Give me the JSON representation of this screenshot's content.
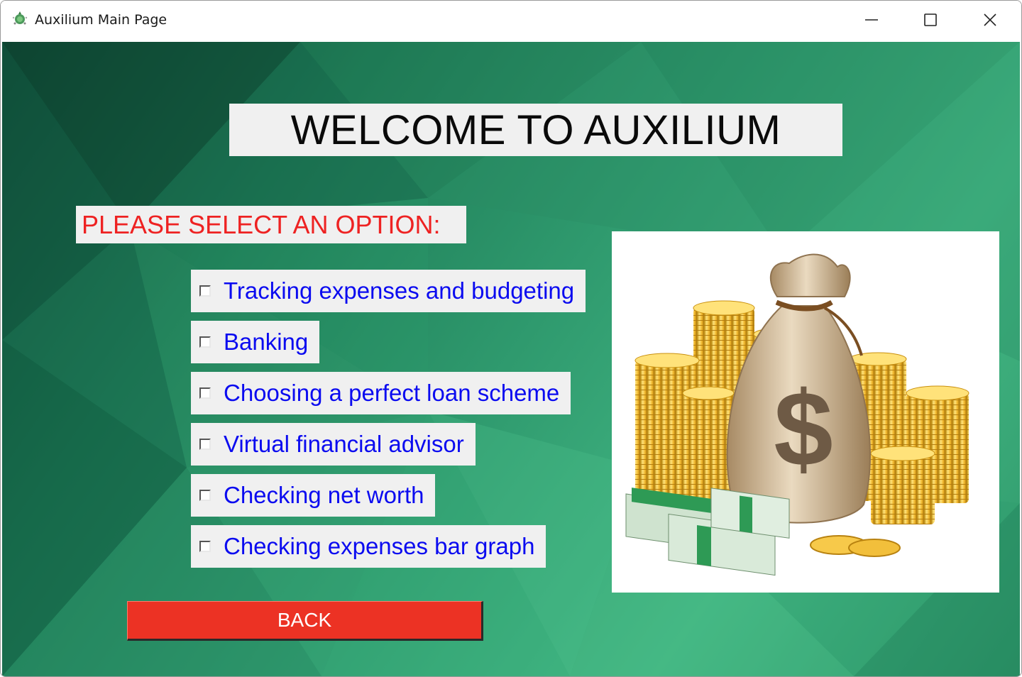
{
  "window": {
    "title": "Auxilium Main Page",
    "icon": "app-icon"
  },
  "controls": {
    "minimize": "minimize-icon",
    "maximize": "maximize-icon",
    "close": "close-icon"
  },
  "header": {
    "welcome": "WELCOME TO AUXILIUM",
    "prompt": "PLEASE SELECT AN OPTION:"
  },
  "options": [
    {
      "label": "Tracking expenses and budgeting",
      "checked": false
    },
    {
      "label": "Banking",
      "checked": false
    },
    {
      "label": "Choosing a perfect loan scheme",
      "checked": false
    },
    {
      "label": "Virtual financial advisor",
      "checked": false
    },
    {
      "label": "Checking net worth",
      "checked": false
    },
    {
      "label": "Checking expenses bar graph",
      "checked": false
    }
  ],
  "back_button": {
    "label": "BACK"
  },
  "illustration": {
    "dollar_sign": "$",
    "icon": "money-bag-icon"
  },
  "colors": {
    "prompt": "#ee2222",
    "option_text": "#0b0bf0",
    "back_button": "#ec3224",
    "panel_bg": "#f0f0f0"
  }
}
